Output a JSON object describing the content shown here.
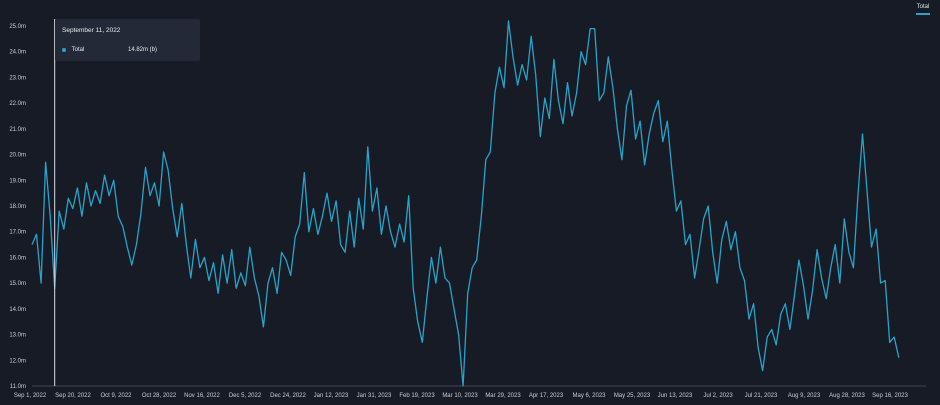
{
  "legend": {
    "label": "Total"
  },
  "tooltip": {
    "date": "September 11, 2022",
    "series": "Total",
    "value": "14.82m (b)"
  },
  "colors": {
    "series": "#29a3c9",
    "background": "#171b26",
    "tooltip_bg": "#232937",
    "crosshair": "#d8dde6",
    "axis": "#6b7080"
  },
  "chart_data": {
    "type": "line",
    "y_ticks": [
      "11.0m",
      "12.0m",
      "13.0m",
      "14.0m",
      "15.0m",
      "16.0m",
      "17.0m",
      "18.0m",
      "19.0m",
      "20.0m",
      "21.0m",
      "22.0m",
      "23.0m",
      "24.0m",
      "25.0m"
    ],
    "x_ticks": [
      "Sep 1, 2022",
      "Sep 20, 2022",
      "Oct 9, 2022",
      "Oct 28, 2022",
      "Nov 16, 2022",
      "Dec 5, 2022",
      "Dec 24, 2022",
      "Jan 12, 2023",
      "Jan 31, 2023",
      "Feb 19, 2023",
      "Mar 10, 2023",
      "Mar 29, 2023",
      "Apr 17, 2023",
      "May 6, 2023",
      "May 25, 2023",
      "Jun 13, 2023",
      "Jul 2, 2023",
      "Jul 21, 2023",
      "Aug 9, 2023",
      "Aug 28, 2023",
      "Sep 16, 2023"
    ],
    "ylim": [
      11.0,
      25.0
    ],
    "x_start": "2022-09-01",
    "x_end": "2023-09-30",
    "crosshair_date": "2022-09-11",
    "series": [
      {
        "name": "Total",
        "points": [
          [
            "2022-09-01",
            16.5
          ],
          [
            "2022-09-03",
            16.9
          ],
          [
            "2022-09-05",
            15.0
          ],
          [
            "2022-09-07",
            19.7
          ],
          [
            "2022-09-09",
            17.6
          ],
          [
            "2022-09-11",
            14.8
          ],
          [
            "2022-09-13",
            17.8
          ],
          [
            "2022-09-15",
            17.1
          ],
          [
            "2022-09-17",
            18.3
          ],
          [
            "2022-09-19",
            17.9
          ],
          [
            "2022-09-21",
            18.7
          ],
          [
            "2022-09-23",
            17.6
          ],
          [
            "2022-09-25",
            18.9
          ],
          [
            "2022-09-27",
            18.0
          ],
          [
            "2022-09-29",
            18.6
          ],
          [
            "2022-10-01",
            18.1
          ],
          [
            "2022-10-03",
            19.2
          ],
          [
            "2022-10-05",
            18.4
          ],
          [
            "2022-10-07",
            19.0
          ],
          [
            "2022-10-09",
            17.6
          ],
          [
            "2022-10-11",
            17.2
          ],
          [
            "2022-10-13",
            16.4
          ],
          [
            "2022-10-15",
            15.7
          ],
          [
            "2022-10-17",
            16.5
          ],
          [
            "2022-10-19",
            17.7
          ],
          [
            "2022-10-21",
            19.5
          ],
          [
            "2022-10-23",
            18.4
          ],
          [
            "2022-10-25",
            18.9
          ],
          [
            "2022-10-27",
            18.0
          ],
          [
            "2022-10-29",
            20.1
          ],
          [
            "2022-10-31",
            19.4
          ],
          [
            "2022-11-02",
            17.9
          ],
          [
            "2022-11-04",
            16.8
          ],
          [
            "2022-11-06",
            18.1
          ],
          [
            "2022-11-08",
            16.5
          ],
          [
            "2022-11-10",
            15.2
          ],
          [
            "2022-11-12",
            16.7
          ],
          [
            "2022-11-14",
            15.6
          ],
          [
            "2022-11-16",
            16.0
          ],
          [
            "2022-11-18",
            15.1
          ],
          [
            "2022-11-20",
            15.8
          ],
          [
            "2022-11-22",
            14.6
          ],
          [
            "2022-11-24",
            16.1
          ],
          [
            "2022-11-26",
            15.0
          ],
          [
            "2022-11-28",
            16.3
          ],
          [
            "2022-11-30",
            14.8
          ],
          [
            "2022-12-02",
            15.4
          ],
          [
            "2022-12-04",
            14.9
          ],
          [
            "2022-12-06",
            16.4
          ],
          [
            "2022-12-08",
            15.2
          ],
          [
            "2022-12-10",
            14.5
          ],
          [
            "2022-12-12",
            13.3
          ],
          [
            "2022-12-14",
            15.0
          ],
          [
            "2022-12-16",
            15.6
          ],
          [
            "2022-12-18",
            14.6
          ],
          [
            "2022-12-20",
            16.2
          ],
          [
            "2022-12-22",
            15.9
          ],
          [
            "2022-12-24",
            15.3
          ],
          [
            "2022-12-26",
            16.8
          ],
          [
            "2022-12-28",
            17.3
          ],
          [
            "2022-12-30",
            19.3
          ],
          [
            "2023-01-01",
            17.0
          ],
          [
            "2023-01-03",
            17.9
          ],
          [
            "2023-01-05",
            16.9
          ],
          [
            "2023-01-07",
            17.6
          ],
          [
            "2023-01-09",
            18.5
          ],
          [
            "2023-01-11",
            17.4
          ],
          [
            "2023-01-13",
            18.2
          ],
          [
            "2023-01-15",
            16.5
          ],
          [
            "2023-01-17",
            16.2
          ],
          [
            "2023-01-19",
            17.8
          ],
          [
            "2023-01-21",
            16.4
          ],
          [
            "2023-01-23",
            18.3
          ],
          [
            "2023-01-25",
            17.1
          ],
          [
            "2023-01-27",
            20.3
          ],
          [
            "2023-01-29",
            17.8
          ],
          [
            "2023-01-31",
            18.7
          ],
          [
            "2023-02-02",
            16.9
          ],
          [
            "2023-02-04",
            18.0
          ],
          [
            "2023-02-06",
            17.0
          ],
          [
            "2023-02-08",
            16.4
          ],
          [
            "2023-02-10",
            17.3
          ],
          [
            "2023-02-12",
            16.6
          ],
          [
            "2023-02-14",
            18.4
          ],
          [
            "2023-02-16",
            14.8
          ],
          [
            "2023-02-18",
            13.5
          ],
          [
            "2023-02-20",
            12.7
          ],
          [
            "2023-02-22",
            14.4
          ],
          [
            "2023-02-24",
            16.0
          ],
          [
            "2023-02-26",
            15.0
          ],
          [
            "2023-02-28",
            16.4
          ],
          [
            "2023-03-02",
            15.2
          ],
          [
            "2023-03-04",
            15.0
          ],
          [
            "2023-03-06",
            14.0
          ],
          [
            "2023-03-08",
            13.0
          ],
          [
            "2023-03-10",
            11.0
          ],
          [
            "2023-03-12",
            14.6
          ],
          [
            "2023-03-14",
            15.6
          ],
          [
            "2023-03-16",
            15.9
          ],
          [
            "2023-03-18",
            17.6
          ],
          [
            "2023-03-20",
            19.8
          ],
          [
            "2023-03-22",
            20.1
          ],
          [
            "2023-03-24",
            22.4
          ],
          [
            "2023-03-26",
            23.4
          ],
          [
            "2023-03-28",
            22.6
          ],
          [
            "2023-03-30",
            25.2
          ],
          [
            "2023-04-01",
            23.8
          ],
          [
            "2023-04-03",
            22.7
          ],
          [
            "2023-04-05",
            23.5
          ],
          [
            "2023-04-07",
            22.9
          ],
          [
            "2023-04-09",
            24.6
          ],
          [
            "2023-04-11",
            23.1
          ],
          [
            "2023-04-13",
            20.7
          ],
          [
            "2023-04-15",
            22.2
          ],
          [
            "2023-04-17",
            21.4
          ],
          [
            "2023-04-19",
            23.7
          ],
          [
            "2023-04-21",
            22.1
          ],
          [
            "2023-04-23",
            21.2
          ],
          [
            "2023-04-25",
            22.8
          ],
          [
            "2023-04-27",
            21.5
          ],
          [
            "2023-04-29",
            22.4
          ],
          [
            "2023-05-01",
            24.0
          ],
          [
            "2023-05-03",
            23.5
          ],
          [
            "2023-05-05",
            24.9
          ],
          [
            "2023-05-07",
            24.9
          ],
          [
            "2023-05-09",
            22.1
          ],
          [
            "2023-05-11",
            22.4
          ],
          [
            "2023-05-13",
            23.8
          ],
          [
            "2023-05-15",
            22.6
          ],
          [
            "2023-05-17",
            21.0
          ],
          [
            "2023-05-19",
            19.8
          ],
          [
            "2023-05-21",
            21.9
          ],
          [
            "2023-05-23",
            22.5
          ],
          [
            "2023-05-25",
            20.6
          ],
          [
            "2023-05-27",
            21.3
          ],
          [
            "2023-05-29",
            19.6
          ],
          [
            "2023-05-31",
            20.8
          ],
          [
            "2023-06-02",
            21.6
          ],
          [
            "2023-06-04",
            22.1
          ],
          [
            "2023-06-06",
            20.5
          ],
          [
            "2023-06-08",
            21.3
          ],
          [
            "2023-06-10",
            19.4
          ],
          [
            "2023-06-12",
            17.8
          ],
          [
            "2023-06-14",
            18.2
          ],
          [
            "2023-06-16",
            16.5
          ],
          [
            "2023-06-18",
            16.9
          ],
          [
            "2023-06-20",
            15.2
          ],
          [
            "2023-06-22",
            16.3
          ],
          [
            "2023-06-24",
            17.5
          ],
          [
            "2023-06-26",
            18.0
          ],
          [
            "2023-06-28",
            16.2
          ],
          [
            "2023-06-30",
            15.0
          ],
          [
            "2023-07-02",
            16.7
          ],
          [
            "2023-07-04",
            17.4
          ],
          [
            "2023-07-06",
            16.3
          ],
          [
            "2023-07-08",
            17.0
          ],
          [
            "2023-07-10",
            15.6
          ],
          [
            "2023-07-12",
            15.1
          ],
          [
            "2023-07-14",
            13.6
          ],
          [
            "2023-07-16",
            14.2
          ],
          [
            "2023-07-18",
            12.5
          ],
          [
            "2023-07-20",
            11.6
          ],
          [
            "2023-07-22",
            12.9
          ],
          [
            "2023-07-24",
            13.2
          ],
          [
            "2023-07-26",
            12.6
          ],
          [
            "2023-07-28",
            13.8
          ],
          [
            "2023-07-30",
            14.2
          ],
          [
            "2023-08-01",
            13.2
          ],
          [
            "2023-08-03",
            14.5
          ],
          [
            "2023-08-05",
            15.9
          ],
          [
            "2023-08-07",
            14.9
          ],
          [
            "2023-08-09",
            13.6
          ],
          [
            "2023-08-11",
            14.7
          ],
          [
            "2023-08-13",
            16.3
          ],
          [
            "2023-08-15",
            15.2
          ],
          [
            "2023-08-17",
            14.4
          ],
          [
            "2023-08-19",
            15.6
          ],
          [
            "2023-08-21",
            16.5
          ],
          [
            "2023-08-23",
            15.0
          ],
          [
            "2023-08-25",
            17.5
          ],
          [
            "2023-08-27",
            16.2
          ],
          [
            "2023-08-29",
            15.6
          ],
          [
            "2023-08-31",
            18.4
          ],
          [
            "2023-09-02",
            20.8
          ],
          [
            "2023-09-04",
            18.6
          ],
          [
            "2023-09-06",
            16.4
          ],
          [
            "2023-09-08",
            17.1
          ],
          [
            "2023-09-10",
            15.0
          ],
          [
            "2023-09-12",
            15.1
          ],
          [
            "2023-09-14",
            12.7
          ],
          [
            "2023-09-16",
            12.9
          ],
          [
            "2023-09-18",
            12.1
          ]
        ]
      }
    ]
  }
}
